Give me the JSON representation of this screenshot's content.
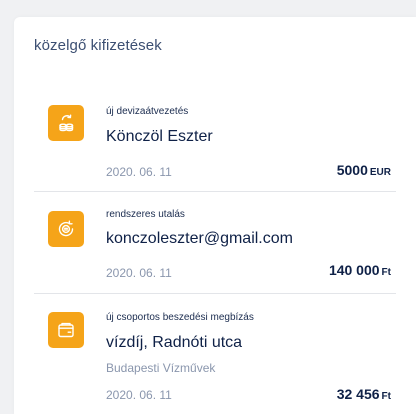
{
  "section_title": "közelgő kifizetések",
  "accent_color": "#f5a419",
  "payments": [
    {
      "icon": "coins-exchange-icon",
      "type_label": "új devizaátvezetés",
      "name": "Könczöl Eszter",
      "date": "2020. 06. 11",
      "amount": "5000",
      "currency": "EUR"
    },
    {
      "icon": "recurring-coin-icon",
      "type_label": "rendszeres utalás",
      "name": "konczoleszter@gmail.com",
      "date": "2020. 06. 11",
      "amount": "140 000",
      "currency": "Ft"
    },
    {
      "icon": "wallet-icon",
      "type_label": "új csoportos beszedési megbízás",
      "name": "vízdíj, Radnóti utca",
      "subtitle": "Budapesti Vízművek",
      "date": "2020. 06. 11",
      "amount": "32 456",
      "currency": "Ft"
    }
  ]
}
